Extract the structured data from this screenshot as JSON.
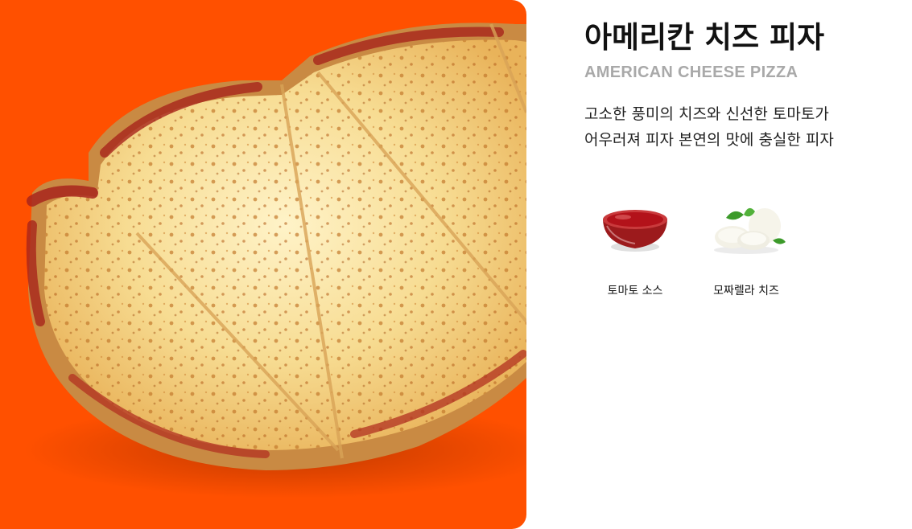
{
  "product": {
    "name_ko": "아메리칸 치즈 피자",
    "name_en": "AMERICAN CHEESE PIZZA",
    "description_lines": [
      "고소한 풍미의 치즈와 신선한 토마토가",
      "어우러져 피자 본연의 맛에 충실한 피자"
    ]
  },
  "hero": {
    "background_color": "#ff5000",
    "image": "pizza-photo"
  },
  "ingredients": [
    {
      "label": "토마토 소스",
      "icon": "tomato-sauce-bowl-icon"
    },
    {
      "label": "모짜렐라 치즈",
      "icon": "mozzarella-cheese-icon"
    }
  ]
}
